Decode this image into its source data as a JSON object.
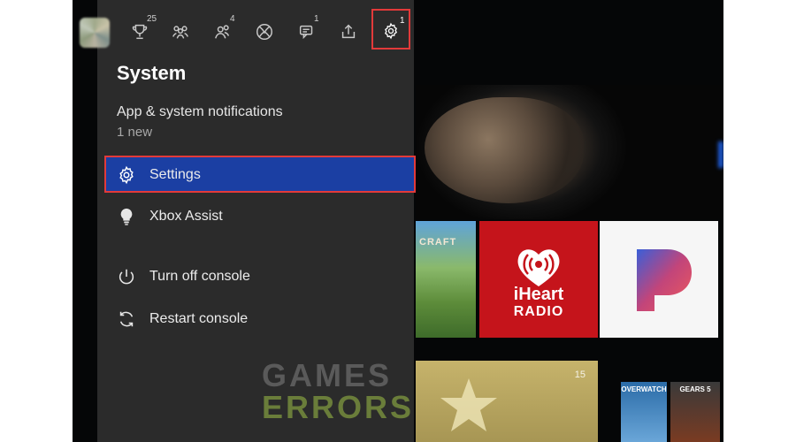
{
  "top_bar": {
    "achievements_count": "25",
    "friends_count": "4",
    "messages_count": "1",
    "settings_count": "1",
    "icons": [
      "trophy-icon",
      "party-icon",
      "people-icon",
      "xbox-icon",
      "chat-icon",
      "share-icon",
      "gear-icon"
    ]
  },
  "panel": {
    "title": "System",
    "notifications_label": "App & system notifications",
    "notifications_sub": "1 new",
    "items": [
      {
        "label": "Settings",
        "icon": "gear-icon",
        "selected": true
      },
      {
        "label": "Xbox Assist",
        "icon": "lightbulb-icon"
      },
      {
        "label": "Turn off console",
        "icon": "power-icon"
      },
      {
        "label": "Restart console",
        "icon": "restart-icon"
      }
    ]
  },
  "background_tiles": {
    "minecraft_text": "CRAFT",
    "iheart_line1": "iHeart",
    "iheart_line2": "RADIO",
    "star_tile_label": "15",
    "overwatch_label": "OVERWATCH",
    "gears_label": "GEARS 5"
  },
  "watermark": {
    "line1": "GAMES",
    "line2": "ERRORS"
  },
  "colors": {
    "panel_bg": "#2b2b2b",
    "selected_bg": "#1b3fa3",
    "highlight_border": "#e23a3a",
    "iheart_red": "#c5141b",
    "watermark_green": "#6a7d3a"
  }
}
